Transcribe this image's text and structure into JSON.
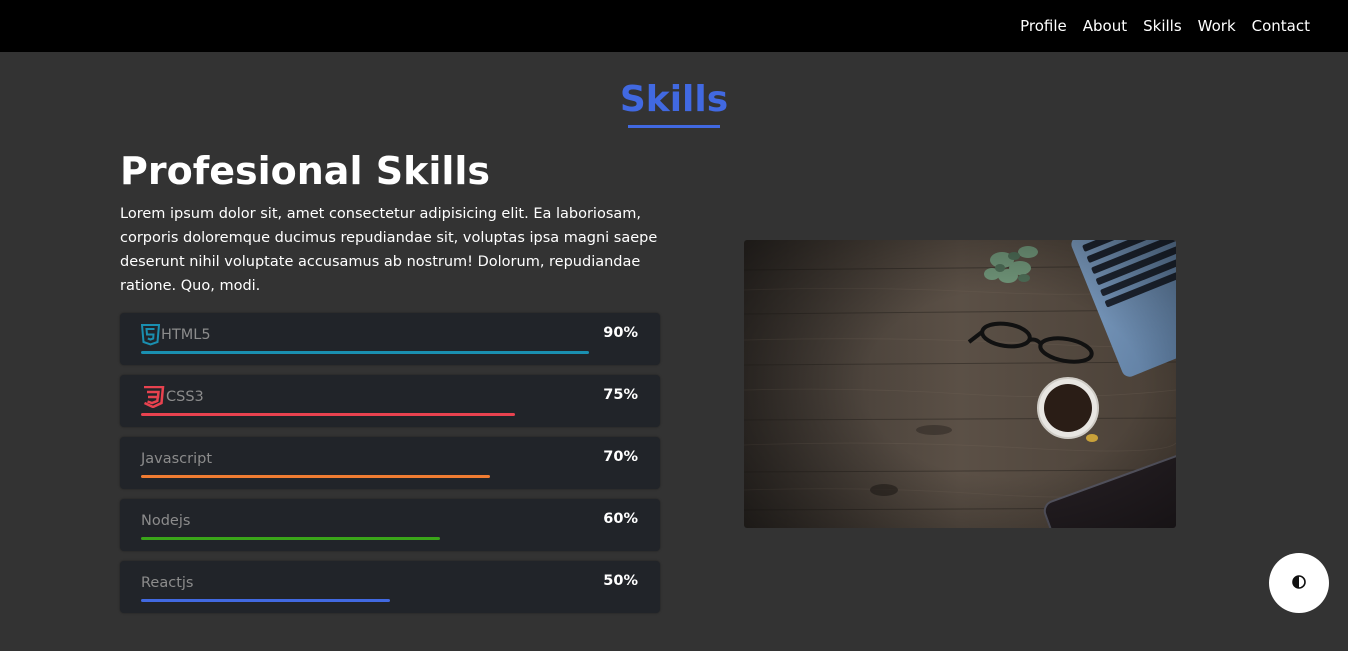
{
  "nav": {
    "items": [
      {
        "label": "Profile"
      },
      {
        "label": "About"
      },
      {
        "label": "Skills"
      },
      {
        "label": "Work"
      },
      {
        "label": "Contact"
      }
    ]
  },
  "section": {
    "title": "Skills"
  },
  "main": {
    "heading": "Profesional Skills",
    "description": "Lorem ipsum dolor sit, amet consectetur adipisicing elit. Ea laboriosam, corporis doloremque ducimus repudiandae sit, voluptas ipsa magni saepe deserunt nihil voluptate accusamus ab nostrum! Dolorum, repudiandae ratione. Quo, modi."
  },
  "skills": [
    {
      "name": "HTML5",
      "percent_label": "90%",
      "level": 0.9,
      "color": "#1a8fb0",
      "icon": "html5-icon"
    },
    {
      "name": "CSS3",
      "percent_label": "75%",
      "level": 0.75,
      "color": "#e8424f",
      "icon": "css3-icon"
    },
    {
      "name": "Javascript",
      "percent_label": "70%",
      "level": 0.7,
      "color": "#f07c32",
      "icon": null
    },
    {
      "name": "Nodejs",
      "percent_label": "60%",
      "level": 0.6,
      "color": "#3aa519",
      "icon": null
    },
    {
      "name": "Reactjs",
      "percent_label": "50%",
      "level": 0.5,
      "color": "#4169e1",
      "icon": null
    }
  ],
  "colors": {
    "accent": "#4169e1",
    "background": "#333333",
    "navbar": "#000000",
    "card": "#212429"
  },
  "theme_toggle": {
    "icon": "contrast-icon"
  }
}
